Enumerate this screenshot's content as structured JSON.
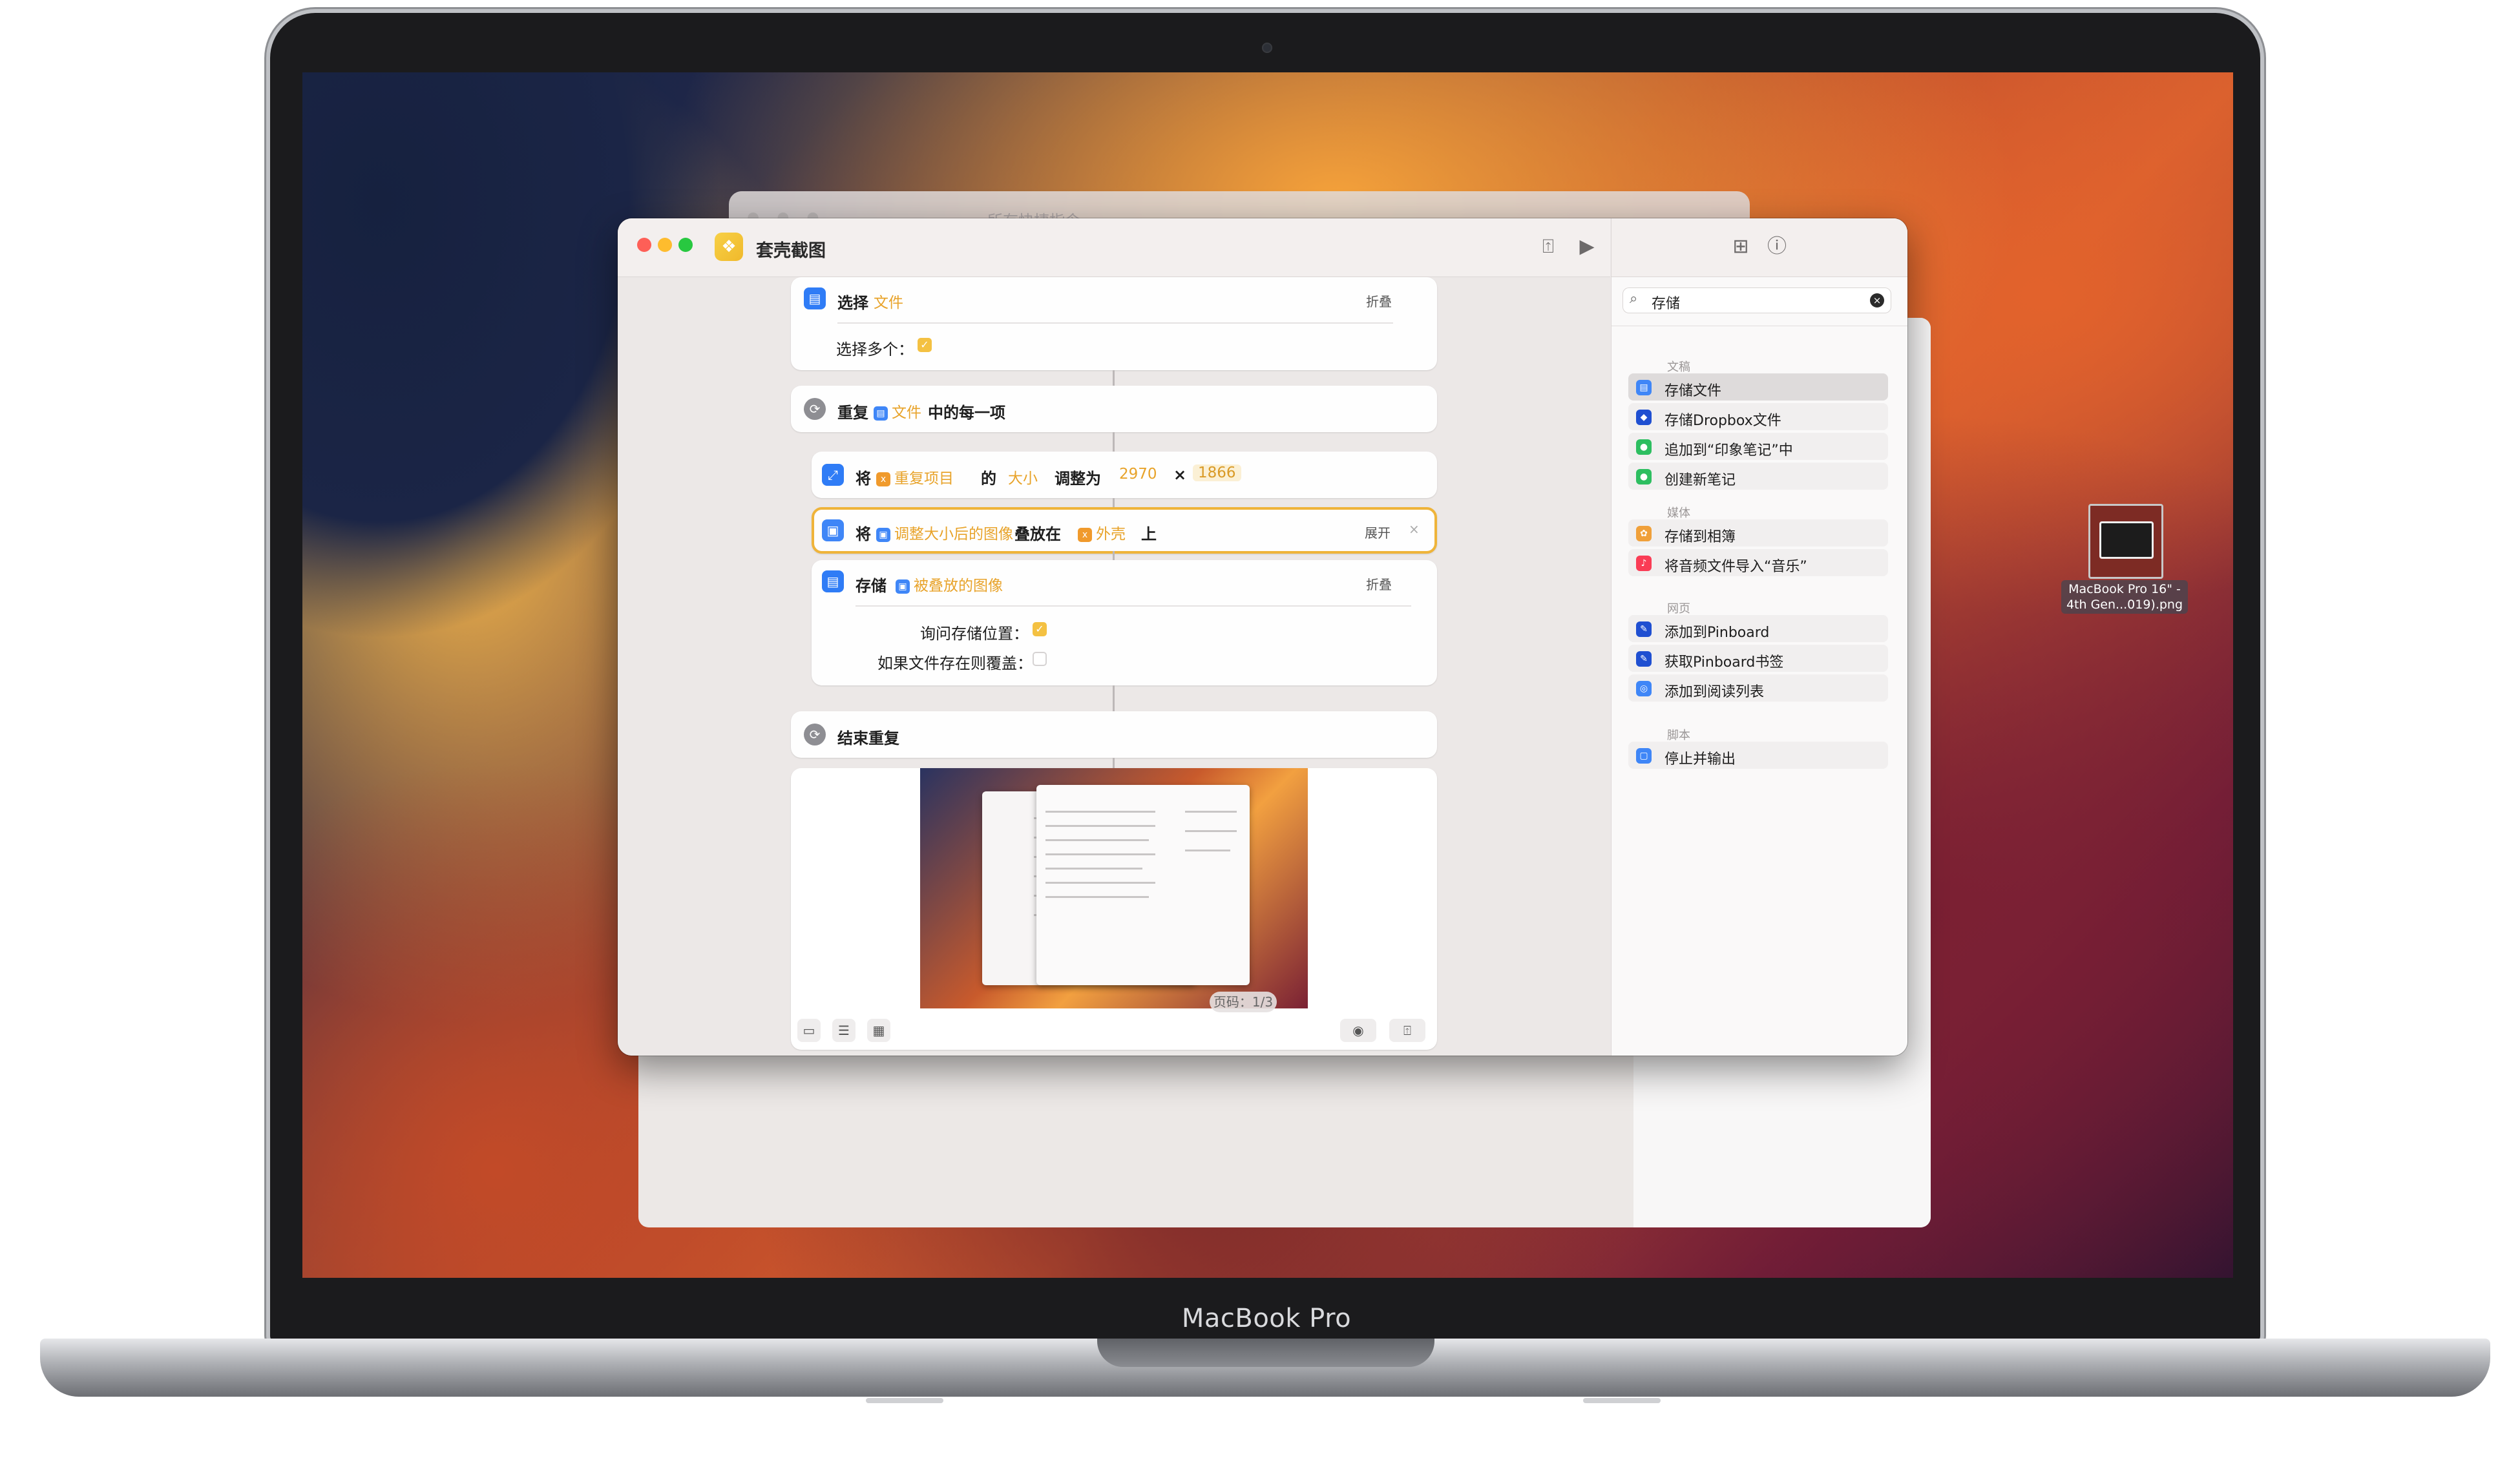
{
  "device": {
    "brand": "MacBook Pro"
  },
  "background_window": {
    "title": "所有快捷指令"
  },
  "window": {
    "title": "套壳截图",
    "app_icon": "shortcuts-icon",
    "toolbar": {
      "share_icon": "share-icon",
      "run_icon": "play-icon",
      "library_icon": "add-to-library-icon",
      "info_icon": "info-icon"
    }
  },
  "actions": {
    "select_file": {
      "verb": "选择",
      "param": "文件",
      "collapse": "折叠",
      "multi_label": "选择多个：",
      "multi_checked": true
    },
    "repeat": {
      "verb": "重复",
      "param": "文件",
      "suffix": "中的每一项"
    },
    "resize": {
      "verb": "将",
      "token": "重复项目",
      "de": "的",
      "size": "大小",
      "adjust": "调整为",
      "width": "2970",
      "times": "×",
      "height": "1866"
    },
    "overlay": {
      "verb": "将",
      "token": "调整大小后的图像",
      "place": "叠放在",
      "target": "外壳",
      "on": "上",
      "expand": "展开",
      "close": "×"
    },
    "save": {
      "verb": "存储",
      "token": "被叠放的图像",
      "collapse": "折叠",
      "ask_label": "询问存储位置：",
      "ask_checked": true,
      "overwrite_label": "如果文件存在则覆盖：",
      "overwrite_checked": false
    },
    "end_repeat": {
      "label": "结束重复"
    }
  },
  "preview": {
    "page_indicator": "页码：1/3"
  },
  "library": {
    "search": {
      "value": "存储",
      "icon": "search-icon",
      "clear_icon": "clear-icon"
    },
    "sections": [
      {
        "title": "文稿",
        "items": [
          {
            "label": "存储文件",
            "icon": "file-icon",
            "color": "#3f86f7",
            "highlighted": true
          },
          {
            "label": "存储Dropbox文件",
            "icon": "dropbox-icon",
            "color": "#1f4fd1"
          },
          {
            "label": "追加到“印象笔记”中",
            "icon": "evernote-icon",
            "color": "#2dbe60"
          },
          {
            "label": "创建新笔记",
            "icon": "evernote-icon",
            "color": "#2dbe60"
          }
        ]
      },
      {
        "title": "媒体",
        "items": [
          {
            "label": "存储到相簿",
            "icon": "photos-icon",
            "color": "#f0a03a"
          },
          {
            "label": "将音频文件导入“音乐”",
            "icon": "music-icon",
            "color": "#fa3c55"
          }
        ]
      },
      {
        "title": "网页",
        "items": [
          {
            "label": "添加到Pinboard",
            "icon": "pinboard-icon",
            "color": "#1f4fd1"
          },
          {
            "label": "获取Pinboard书签",
            "icon": "pinboard-icon",
            "color": "#1f4fd1"
          },
          {
            "label": "添加到阅读列表",
            "icon": "safari-icon",
            "color": "#3f86f7"
          }
        ]
      },
      {
        "title": "脚本",
        "items": [
          {
            "label": "停止并输出",
            "icon": "stop-output-icon",
            "color": "#3f86f7"
          }
        ]
      }
    ]
  },
  "desktop_file": {
    "label_line1": "MacBook Pro 16\" -",
    "label_line2": "4th Gen...019).png"
  }
}
